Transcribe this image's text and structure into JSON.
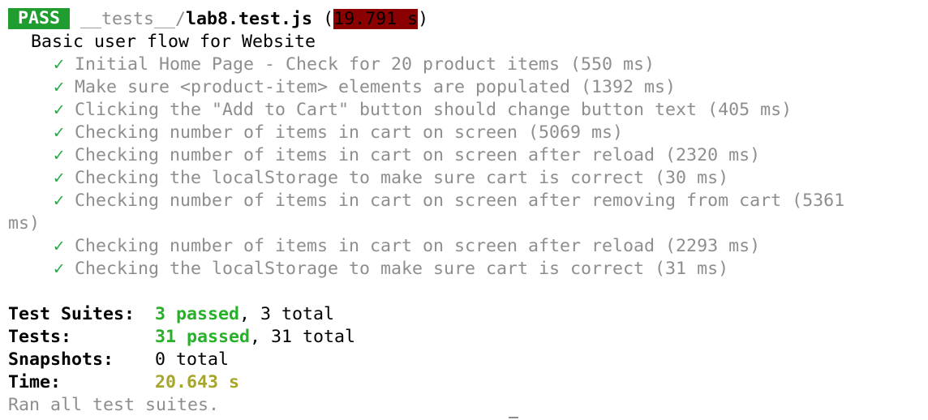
{
  "header": {
    "status": "PASS",
    "path_dir": "__tests__/",
    "file_name": "lab8.test.js",
    "paren_open": " (",
    "duration": "19.791 s",
    "paren_close": ")"
  },
  "suite": {
    "title": "Basic user flow for Website",
    "check_glyph": "✓",
    "tests": [
      {
        "name": "Initial Home Page - Check for 20 product items (550 ms)"
      },
      {
        "name": "Make sure <product-item> elements are populated (1392 ms)"
      },
      {
        "name": "Clicking the \"Add to Cart\" button should change button text (405 ms)"
      },
      {
        "name": "Checking number of items in cart on screen (5069 ms)"
      },
      {
        "name": "Checking number of items in cart on screen after reload (2320 ms)"
      },
      {
        "name": "Checking the localStorage to make sure cart is correct (30 ms)"
      },
      {
        "name": "Checking number of items in cart on screen after removing from cart (5361",
        "wrap": "ms)"
      },
      {
        "name": "Checking number of items in cart on screen after reload (2293 ms)"
      },
      {
        "name": "Checking the localStorage to make sure cart is correct (31 ms)"
      }
    ]
  },
  "summary": {
    "suites_label": "Test Suites:",
    "suites_passed": "3 passed",
    "suites_total": ", 3 total",
    "tests_label": "Tests:",
    "tests_passed": "31 passed",
    "tests_total": ", 31 total",
    "snapshots_label": "Snapshots:",
    "snapshots_value": "0 total",
    "time_label": "Time:",
    "time_value": "20.643 s",
    "footer": "Ran all test suites."
  },
  "colors": {
    "pass_bg": "#1f9d2f",
    "slow_bg": "#8b0000",
    "check": "#28a745",
    "passed_text": "#28b02a",
    "time_text": "#a6a52c",
    "dim_text": "#8e8e8e"
  }
}
